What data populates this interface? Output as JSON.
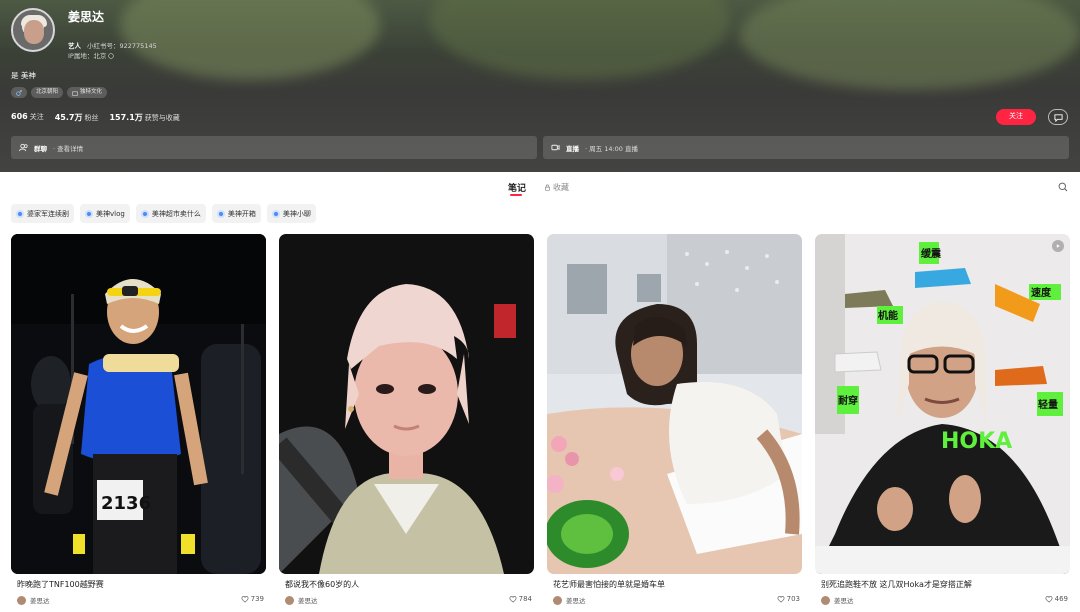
{
  "profile": {
    "name": "姜思达",
    "role": "艺人",
    "id_label": "小红书号：922775145",
    "ip_label": "IP属地：北京",
    "bio": "是 美神",
    "tags": [
      {
        "icon": "male-icon",
        "label": ""
      },
      {
        "icon": "",
        "label": "北京朝阳"
      },
      {
        "icon": "shop-icon",
        "label": "独特文化"
      }
    ],
    "stats": [
      {
        "value": "606",
        "label": "关注"
      },
      {
        "value": "45.7万",
        "label": "粉丝"
      },
      {
        "value": "157.1万",
        "label": "获赞与收藏"
      }
    ],
    "follow_label": "关注",
    "group_chat": {
      "title": "群聊",
      "sub": "· 查看详情"
    },
    "live": {
      "title": "直播",
      "sub": "· 周五 14:00 直播"
    }
  },
  "tabs": {
    "notes": "笔记",
    "favorites": "收藏"
  },
  "chips": [
    "婆家军连续剧",
    "美神vlog",
    "美神超市卖什么",
    "美神开箱",
    "美神小聊"
  ],
  "notes": [
    {
      "title": "昨晚跑了TNF100越野赛",
      "author": "姜思达",
      "likes": "739",
      "bib": "2136"
    },
    {
      "title": "都说我不像60岁的人",
      "author": "姜思达",
      "likes": "784"
    },
    {
      "title": "花艺师最害怕接的单就是婚车单",
      "author": "姜思达",
      "likes": "703"
    },
    {
      "title": "别死追跑鞋不放 这几双Hoka才是穿搭正解",
      "author": "姜思达",
      "likes": "469",
      "brand": "HOKA",
      "stickers": [
        "缓震",
        "速度",
        "机能",
        "耐穿",
        "轻量"
      ]
    }
  ],
  "colors": {
    "accent": "#ff2442",
    "chip_icon": "#4c8bf5",
    "hoka_green": "#5ef03c"
  }
}
